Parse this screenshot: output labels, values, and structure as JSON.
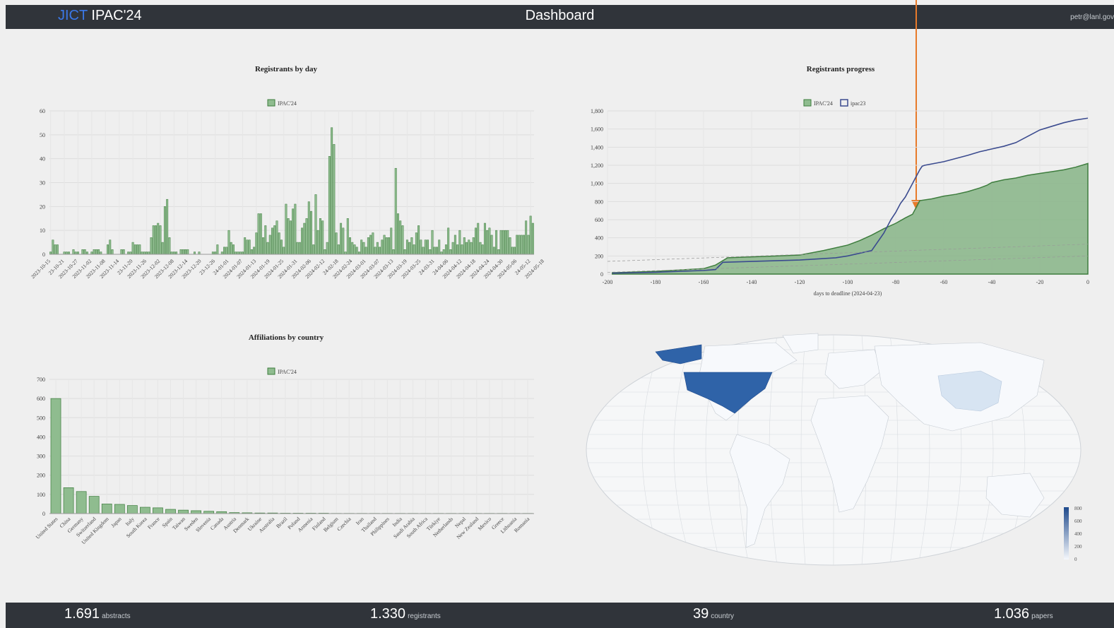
{
  "header": {
    "brand_prefix": "JICT",
    "brand_name": "IPAC'24",
    "title": "Dashboard",
    "user": "petr@lanl.gov"
  },
  "footer": {
    "stats": [
      {
        "value": "1.691",
        "label": "abstracts"
      },
      {
        "value": "1.330",
        "label": "registrants"
      },
      {
        "value": "39",
        "label": "country"
      },
      {
        "value": "1.036",
        "label": "papers"
      }
    ]
  },
  "colors": {
    "bar": "#8fbc8f",
    "bar_stroke": "#3e7d3e",
    "ipac23": "#3b4b8f",
    "area": "#86b486",
    "map_high": "#2f63a8",
    "map_low": "#f5f8fc"
  },
  "chart_data": [
    {
      "type": "bar",
      "title": "Registrants by day",
      "legend": [
        "IPAC'24"
      ],
      "ylim": [
        0,
        60
      ],
      "yticks": [
        0,
        10,
        20,
        30,
        40,
        50,
        60
      ],
      "tick_labels": [
        "2023-10-15",
        "23-10-21",
        "2023-10-27",
        "2023-11-02",
        "2023-11-08",
        "2023-11-14",
        "23-11-20",
        "2023-11-26",
        "2023-12-02",
        "2023-12-08",
        "2023-12-14",
        "2023-12-20",
        "23-12-26",
        "24-01-01",
        "2024-01-07",
        "2024-01-13",
        "2024-01-19",
        "2024-01-25",
        "2024-01-31",
        "2024-02-06",
        "2024-02-12",
        "24-02-18",
        "2024-02-24",
        "2024-03-01",
        "2024-03-07",
        "2024-03-13",
        "2024-03-19",
        "2024-03-25",
        "24-03-31",
        "24-04-06",
        "2024-04-12",
        "2024-04-18",
        "2024-04-24",
        "2024-04-30",
        "2024-05-06",
        "24-05-12",
        "2024-05-18"
      ],
      "values": [
        1,
        6,
        4,
        4,
        0,
        0,
        1,
        1,
        1,
        0,
        2,
        1,
        1,
        0,
        2,
        2,
        1,
        0,
        1,
        2,
        2,
        2,
        1,
        0,
        0,
        4,
        6,
        2,
        0,
        0,
        0,
        2,
        2,
        0,
        1,
        1,
        5,
        4,
        4,
        4,
        1,
        1,
        1,
        1,
        7,
        12,
        12,
        13,
        12,
        5,
        20,
        23,
        7,
        1,
        1,
        1,
        0,
        2,
        2,
        2,
        2,
        0,
        0,
        1,
        0,
        1,
        0,
        0,
        0,
        0,
        0,
        1,
        1,
        4,
        0,
        1,
        3,
        3,
        10,
        5,
        4,
        1,
        1,
        1,
        1,
        7,
        6,
        6,
        2,
        3,
        9,
        17,
        17,
        7,
        12,
        5,
        8,
        11,
        12,
        14,
        9,
        6,
        3,
        21,
        15,
        14,
        19,
        21,
        5,
        5,
        11,
        13,
        15,
        22,
        18,
        4,
        25,
        10,
        15,
        14,
        2,
        5,
        41,
        53,
        46,
        9,
        4,
        13,
        11,
        1,
        15,
        7,
        5,
        4,
        3,
        1,
        6,
        5,
        3,
        7,
        8,
        9,
        3,
        5,
        3,
        6,
        8,
        7,
        7,
        11,
        2,
        36,
        17,
        14,
        12,
        2,
        6,
        5,
        7,
        4,
        9,
        12,
        6,
        3,
        6,
        6,
        2,
        10,
        3,
        3,
        6,
        1,
        2,
        4,
        11,
        2,
        5,
        8,
        4,
        10,
        4,
        7,
        5,
        6,
        5,
        7,
        11,
        13,
        5,
        4,
        13,
        10,
        11,
        8,
        3,
        10,
        2,
        10,
        10,
        10,
        10,
        7,
        3,
        3,
        8,
        8,
        8,
        8,
        14,
        8,
        16,
        13
      ],
      "xlabel": "",
      "ylabel": ""
    },
    {
      "type": "area",
      "title": "Registrants progress",
      "legend": [
        "IPAC'24",
        "ipac23"
      ],
      "xlabel": "days to deadline (2024-04-23)",
      "ylabel": "",
      "xlim": [
        -200,
        0
      ],
      "ylim": [
        0,
        1800
      ],
      "xticks": [
        -200,
        -180,
        -160,
        -140,
        -120,
        -100,
        -80,
        -60,
        -40,
        -20,
        0
      ],
      "yticks": [
        0,
        200,
        400,
        600,
        800,
        1000,
        1200,
        1400,
        1600,
        1800
      ],
      "ytick_labels": [
        "0",
        "200",
        "400",
        "600",
        "800",
        "1,000",
        "1,200",
        "1,400",
        "1,600",
        "1,800"
      ],
      "series": [
        {
          "name": "IPAC'24",
          "x": [
            -198,
            -180,
            -160,
            -155,
            -150,
            -140,
            -130,
            -120,
            -110,
            -100,
            -95,
            -90,
            -85,
            -80,
            -76,
            -73,
            -70,
            -65,
            -60,
            -55,
            -50,
            -45,
            -42,
            -40,
            -35,
            -30,
            -25,
            -20,
            -15,
            -10,
            -5,
            0
          ],
          "y": [
            15,
            30,
            60,
            100,
            180,
            190,
            200,
            210,
            260,
            320,
            370,
            430,
            500,
            560,
            620,
            660,
            810,
            830,
            860,
            880,
            910,
            950,
            980,
            1010,
            1040,
            1060,
            1090,
            1110,
            1130,
            1150,
            1180,
            1220
          ]
        },
        {
          "name": "ipac23",
          "x": [
            -198,
            -180,
            -160,
            -155,
            -152,
            -140,
            -120,
            -105,
            -100,
            -90,
            -85,
            -82,
            -80,
            -78,
            -76,
            -74,
            -72,
            -70,
            -69,
            -68,
            -60,
            -50,
            -45,
            -40,
            -35,
            -30,
            -25,
            -20,
            -15,
            -10,
            -5,
            0
          ],
          "y": [
            10,
            20,
            40,
            50,
            130,
            140,
            155,
            180,
            200,
            260,
            450,
            600,
            680,
            780,
            850,
            950,
            1050,
            1150,
            1190,
            1200,
            1240,
            1310,
            1350,
            1380,
            1410,
            1450,
            1520,
            1590,
            1630,
            1670,
            1700,
            1720
          ]
        }
      ]
    },
    {
      "type": "bar",
      "title": "Affiliations by country",
      "legend": [
        "IPAC'24"
      ],
      "ylim": [
        0,
        700
      ],
      "yticks": [
        0,
        100,
        200,
        300,
        400,
        500,
        600,
        700
      ],
      "categories": [
        "United States",
        "China",
        "Germany",
        "Switzerland",
        "United Kingdom",
        "Japan",
        "Italy",
        "South Korea",
        "France",
        "Spain",
        "Taiwan",
        "Sweden",
        "Slovenia",
        "Canada",
        "Austria",
        "Denmark",
        "Ukraine",
        "Australia",
        "Brazil",
        "Poland",
        "Armenia",
        "Finland",
        "Belgium",
        "Czechia",
        "Iran",
        "Thailand",
        "Philippines",
        "India",
        "Saudi Arabia",
        "South Africa",
        "Türkiye",
        "Netherlands",
        "Nepal",
        "New Zealand",
        "Mexico",
        "Greece",
        "Lithuania",
        "Romania"
      ],
      "values": [
        600,
        135,
        115,
        90,
        50,
        48,
        42,
        33,
        30,
        22,
        18,
        15,
        12,
        10,
        5,
        4,
        3,
        3,
        2,
        2,
        2,
        2,
        1,
        1,
        1,
        1,
        1,
        1,
        1,
        1,
        1,
        1,
        1,
        1,
        1,
        1,
        1,
        1
      ],
      "xlabel": "",
      "ylabel": ""
    },
    {
      "type": "heatmap",
      "title": "",
      "colorbar_ticks": [
        0,
        200,
        400,
        600,
        800
      ]
    }
  ]
}
